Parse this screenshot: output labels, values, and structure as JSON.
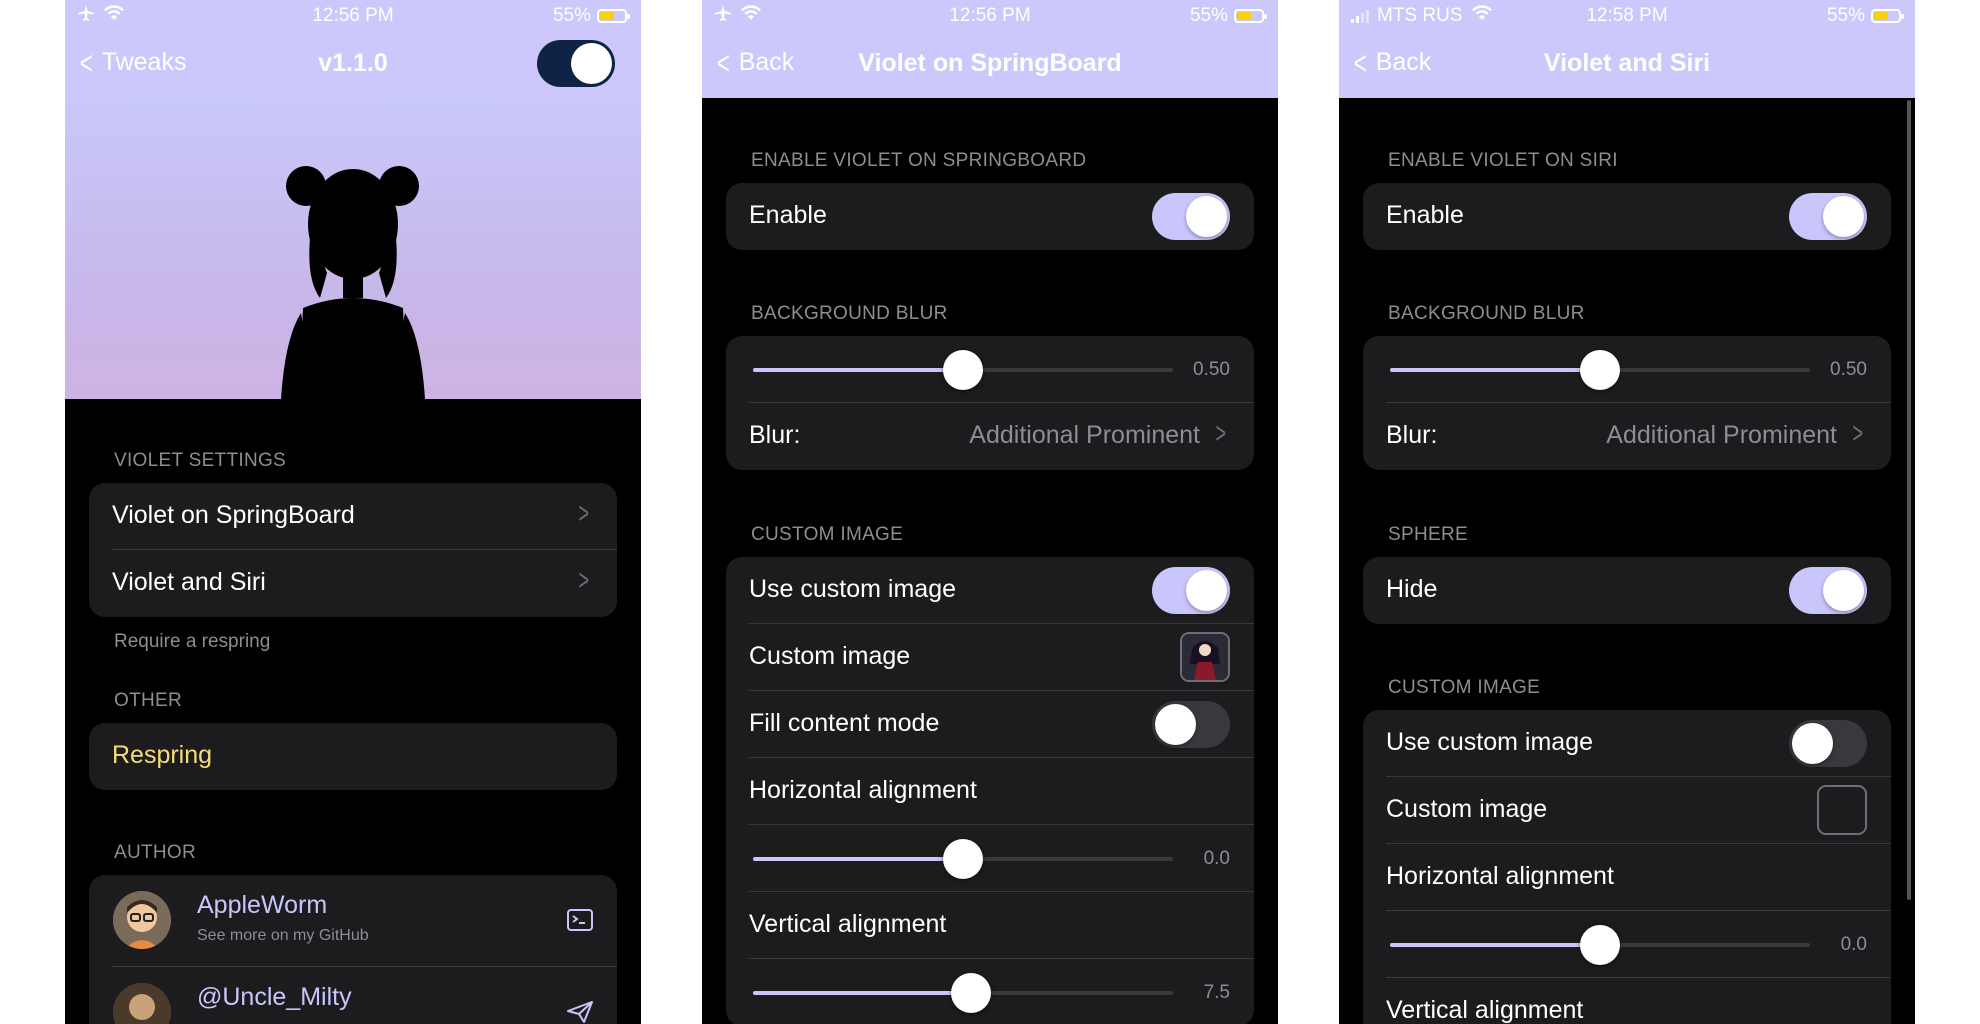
{
  "colors": {
    "accent": "#c8c6fb",
    "header_bg": "#ccc8fb",
    "group_bg": "#1c1c1e",
    "respring": "#f4dd7a",
    "secondary_text": "#8d8d93"
  },
  "screen1": {
    "status": {
      "time": "12:56 PM",
      "battery": "55%",
      "left_icons": [
        "airplane-icon",
        "wifi-icon"
      ]
    },
    "nav": {
      "back_label": "Tweaks",
      "title": "v1.1.0",
      "toggle_on": true
    },
    "violet_settings": {
      "header": "VIOLET SETTINGS",
      "items": [
        {
          "label": "Violet on SpringBoard"
        },
        {
          "label": "Violet and Siri"
        }
      ],
      "footer": "Require a respring"
    },
    "other": {
      "header": "OTHER",
      "respring_label": "Respring"
    },
    "author": {
      "header": "AUTHOR",
      "people": [
        {
          "name": "AppleWorm",
          "subtitle": "See more on my GitHub",
          "icon": "terminal-icon"
        },
        {
          "name": "@Uncle_Milty",
          "subtitle": "",
          "icon": "paper-plane-icon"
        }
      ]
    }
  },
  "screen2": {
    "status": {
      "time": "12:56 PM",
      "battery": "55%",
      "left_icons": [
        "airplane-icon",
        "wifi-icon"
      ]
    },
    "nav": {
      "back_label": "Back",
      "title": "Violet on SpringBoard"
    },
    "enable_section": {
      "header": "ENABLE VIOLET ON SPRINGBOARD",
      "enable_label": "Enable",
      "enabled": true
    },
    "blur_section": {
      "header": "BACKGROUND BLUR",
      "slider_value": "0.50",
      "slider_fraction": 0.5,
      "blur_label": "Blur:",
      "blur_value": "Additional Prominent"
    },
    "custom_image": {
      "header": "CUSTOM IMAGE",
      "use_custom_label": "Use custom image",
      "use_custom_on": true,
      "custom_image_label": "Custom image",
      "fill_mode_label": "Fill content mode",
      "fill_mode_on": false,
      "horizontal_label": "Horizontal alignment",
      "horizontal_value": "0.0",
      "horizontal_fraction": 0.5,
      "vertical_label": "Vertical alignment",
      "vertical_value": "7.5",
      "vertical_fraction": 0.52
    }
  },
  "screen3": {
    "status": {
      "carrier": "MTS RUS",
      "time": "12:58 PM",
      "battery": "55%"
    },
    "nav": {
      "back_label": "Back",
      "title": "Violet and Siri"
    },
    "enable_section": {
      "header": "ENABLE VIOLET ON SIRI",
      "enable_label": "Enable",
      "enabled": true
    },
    "blur_section": {
      "header": "BACKGROUND BLUR",
      "slider_value": "0.50",
      "slider_fraction": 0.5,
      "blur_label": "Blur:",
      "blur_value": "Additional Prominent"
    },
    "sphere_section": {
      "header": "SPHERE",
      "hide_label": "Hide",
      "hide_on": true
    },
    "custom_image": {
      "header": "CUSTOM IMAGE",
      "use_custom_label": "Use custom image",
      "use_custom_on": false,
      "custom_image_label": "Custom image",
      "horizontal_label": "Horizontal alignment",
      "horizontal_value": "0.0",
      "horizontal_fraction": 0.5,
      "vertical_label": "Vertical alignment"
    }
  }
}
